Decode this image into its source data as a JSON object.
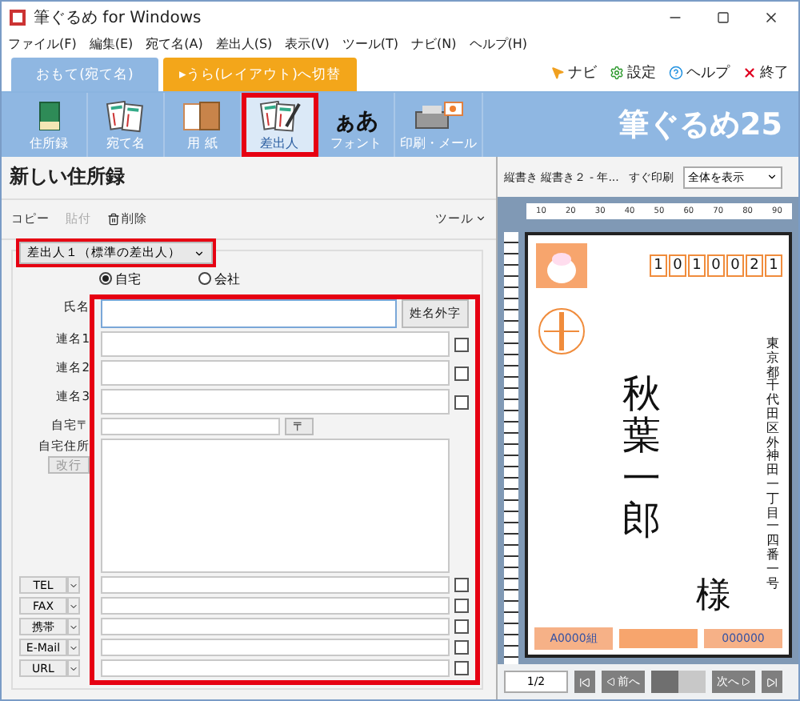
{
  "window": {
    "title": "筆ぐるめ for Windows"
  },
  "menu": [
    "ファイル(F)",
    "編集(E)",
    "宛て名(A)",
    "差出人(S)",
    "表示(V)",
    "ツール(T)",
    "ナビ(N)",
    "ヘルプ(H)"
  ],
  "mode_tabs": [
    {
      "label": "おもて(宛て名)",
      "selected": true
    },
    {
      "label": "▸うら(レイアウト)へ切替",
      "selected": false
    }
  ],
  "top_links": [
    {
      "kind": "navi",
      "label": "ナビ"
    },
    {
      "kind": "settings",
      "label": "設定"
    },
    {
      "kind": "help",
      "label": "ヘルプ"
    },
    {
      "kind": "exit",
      "label": "終了"
    }
  ],
  "toolbar": [
    {
      "kind": "book",
      "label": "住所録",
      "highlighted": false
    },
    {
      "kind": "card",
      "label": "宛て名",
      "highlighted": false
    },
    {
      "kind": "paper",
      "label": "用 紙",
      "highlighted": false
    },
    {
      "kind": "sender",
      "label": "差出人",
      "highlighted": true
    },
    {
      "kind": "font",
      "label": "フォント",
      "glyph": "ぁあ",
      "highlighted": false
    },
    {
      "kind": "print",
      "label": "印刷・メール",
      "highlighted": false
    }
  ],
  "logo": "筆ぐるめ25",
  "panel": {
    "title": "新しい住所録",
    "actions": [
      {
        "label": "コピー",
        "disabled": false
      },
      {
        "label": "貼付",
        "disabled": true
      },
      {
        "label": "削除",
        "disabled": false,
        "kind": "trash"
      }
    ],
    "tools": "ツール",
    "sender_select": {
      "value": "差出人１（標準の差出人）",
      "highlighted": true
    },
    "address_type": [
      {
        "label": "自宅",
        "selected": true
      },
      {
        "label": "会社",
        "selected": false
      }
    ],
    "form": {
      "highlighted": true,
      "rows": [
        {
          "kind": "name",
          "label": "氏名",
          "button": "姓名外字"
        },
        {
          "kind": "joint",
          "label": "連名1",
          "checked": false
        },
        {
          "kind": "joint",
          "label": "連名2",
          "checked": false
        },
        {
          "kind": "joint",
          "label": "連名3",
          "checked": false
        },
        {
          "kind": "zip",
          "label": "自宅〒",
          "button": "〒"
        },
        {
          "kind": "address",
          "label": "自宅住所",
          "button": "改行"
        },
        {
          "kind": "contact",
          "label": "TEL",
          "checked": false
        },
        {
          "kind": "contact",
          "label": "FAX",
          "checked": false
        },
        {
          "kind": "contact",
          "label": "携帯",
          "checked": false
        },
        {
          "kind": "contact",
          "label": "E-Mail",
          "checked": false
        },
        {
          "kind": "contact",
          "label": "URL",
          "checked": false
        }
      ]
    }
  },
  "preview": {
    "layout_name": "縦書き 縦書き２ - 年...",
    "print_button": "すぐ印刷",
    "zoom_select": "全体を表示",
    "ruler_labels": [
      "10",
      "20",
      "30",
      "40",
      "50",
      "60",
      "70",
      "80",
      "90"
    ],
    "card": {
      "zip_digits": [
        "1",
        "0",
        "1",
        "0",
        "0",
        "2",
        "1"
      ],
      "address": "東京都千代田区外神田一丁目一四番一号",
      "name": "秋葉一郎",
      "honorific": "様",
      "lottery_group": "A0000組",
      "lottery_number": "000000"
    },
    "page": "1/2",
    "prev": "前へ",
    "next": "次へ",
    "page_slider": {
      "level": 0.5
    }
  }
}
